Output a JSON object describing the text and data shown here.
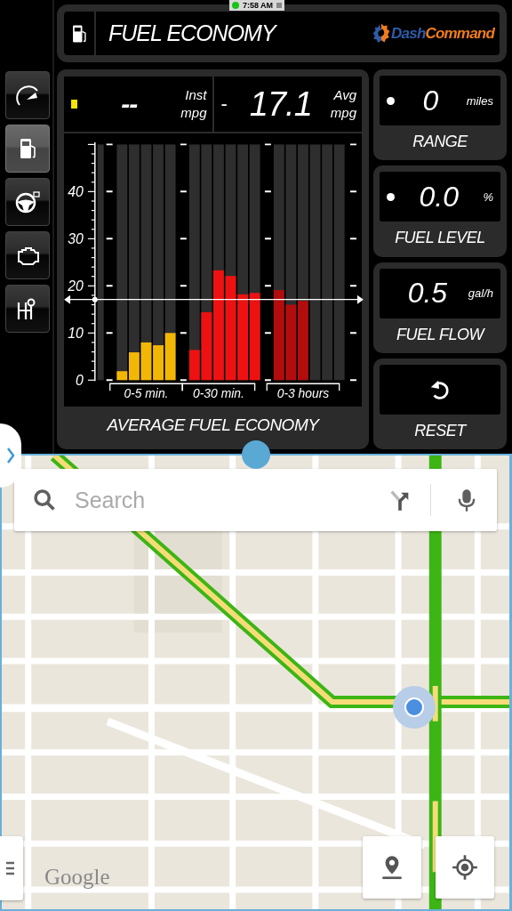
{
  "status_bar": {
    "time": "7:58 AM"
  },
  "sidebar": {
    "items": [
      {
        "kind": "gauge",
        "selected": false
      },
      {
        "kind": "fuel",
        "selected": true
      },
      {
        "kind": "steering",
        "selected": false
      },
      {
        "kind": "engine",
        "selected": false
      },
      {
        "kind": "gearshift",
        "selected": false
      }
    ]
  },
  "header": {
    "title": "FUEL ECONOMY",
    "logo": {
      "part_1": "Dash",
      "part_2": "Command"
    }
  },
  "readouts": [
    {
      "kind": "instant",
      "value": "--",
      "label": "Inst",
      "unit": "mpg"
    },
    {
      "kind": "average",
      "prefix": "-",
      "value": "17.1",
      "label": "Avg",
      "unit": "mpg"
    }
  ],
  "chart_data": {
    "type": "bar",
    "title": "AVERAGE FUEL ECONOMY",
    "stacked": true,
    "grid": true,
    "ylim": [
      0,
      50
    ],
    "yticks": [
      0,
      10,
      20,
      30,
      40
    ],
    "categories": [
      null,
      null,
      "0-5 min.",
      null,
      null,
      null,
      null,
      null,
      "0-30 min.",
      null,
      null,
      null,
      null,
      null,
      null,
      "0-3 hours",
      null,
      null,
      null
    ],
    "series": [
      {
        "color": "#f2b705",
        "values": [
          1.9,
          5.9,
          8.0,
          7.4,
          10.0,
          null,
          null,
          null,
          null,
          null,
          null,
          null,
          null,
          null,
          null,
          null,
          null,
          null,
          null
        ]
      },
      {
        "color": "#ee1111",
        "values": [
          null,
          null,
          null,
          null,
          null,
          null,
          6.4,
          14.4,
          23.3,
          22.1,
          18.2,
          18.5,
          null,
          null,
          null,
          null,
          null,
          null,
          null
        ]
      },
      {
        "color": "#b30c0c",
        "values": [
          null,
          null,
          null,
          null,
          null,
          null,
          null,
          null,
          null,
          null,
          null,
          null,
          null,
          19.1,
          16.0,
          16.8,
          null,
          null,
          null
        ]
      }
    ],
    "ref_lines": [
      {
        "axis": "y",
        "value": 17.1
      }
    ]
  },
  "cards": [
    {
      "kind": "value",
      "indicator": true,
      "value": "0",
      "unit": "miles",
      "label": "RANGE"
    },
    {
      "kind": "value",
      "indicator": true,
      "value": "0.0",
      "unit": "%",
      "label": "FUEL LEVEL"
    },
    {
      "kind": "value",
      "indicator": false,
      "value": "0.5",
      "unit": "gal/h",
      "label": "FUEL FLOW"
    },
    {
      "kind": "button",
      "label": "RESET"
    }
  ],
  "map": {
    "kind": "picture",
    "search": {
      "placeholder": "Search"
    },
    "attribution": "Google"
  }
}
